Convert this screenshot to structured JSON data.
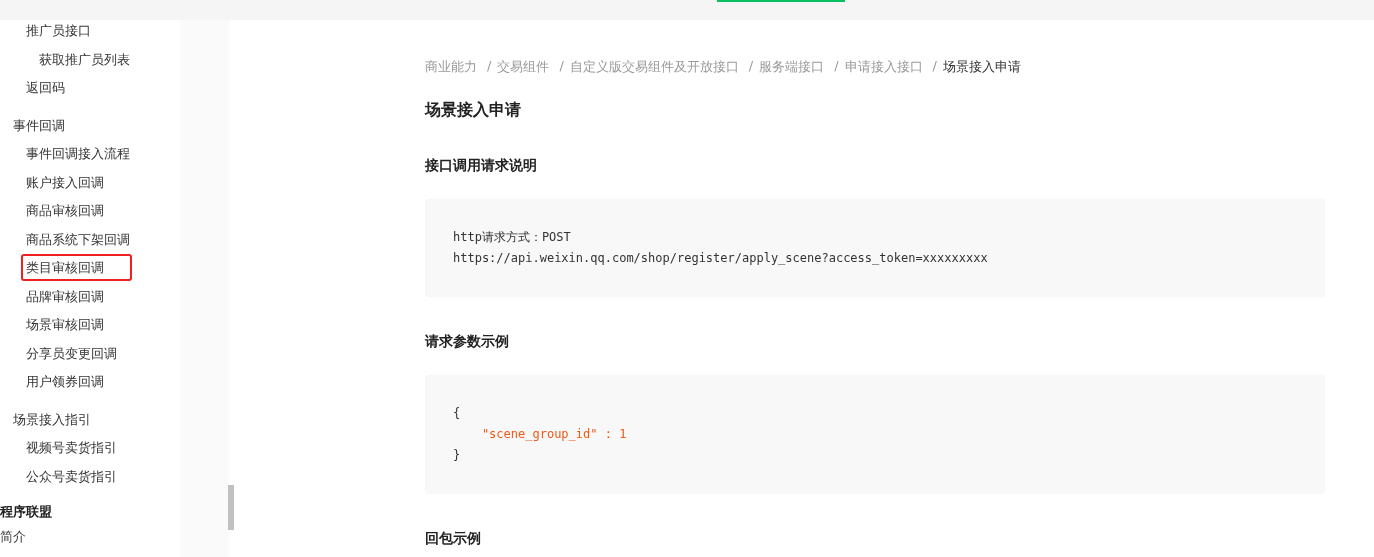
{
  "top_nav": {
    "active_tab": {
      "selected": true
    }
  },
  "sidebar": {
    "tree": [
      {
        "children": [
          {
            "label": "推广员接口",
            "highlighted": false,
            "children": [
              {
                "label": "获取推广员列表",
                "highlighted": false
              }
            ]
          },
          {
            "label": "返回码",
            "highlighted": false
          }
        ]
      },
      {
        "label": "事件回调",
        "highlighted": false,
        "children": [
          {
            "label": "事件回调接入流程",
            "highlighted": false
          },
          {
            "label": "账户接入回调",
            "highlighted": false
          },
          {
            "label": "商品审核回调",
            "highlighted": false
          },
          {
            "label": "商品系统下架回调",
            "highlighted": false
          },
          {
            "label": "类目审核回调",
            "highlighted": true
          },
          {
            "label": "品牌审核回调",
            "highlighted": false
          },
          {
            "label": "场景审核回调",
            "highlighted": false
          },
          {
            "label": "分享员变更回调",
            "highlighted": false
          },
          {
            "label": "用户领券回调",
            "highlighted": false
          }
        ]
      },
      {
        "label": "场景接入指引",
        "highlighted": false,
        "children": [
          {
            "label": "视频号卖货指引",
            "highlighted": false
          },
          {
            "label": "公众号卖货指引",
            "highlighted": false
          }
        ]
      }
    ],
    "next_section": {
      "title": "程序联盟",
      "items": [
        "简介"
      ]
    }
  },
  "breadcrumb": {
    "separator": "/",
    "items": [
      "商业能力",
      "交易组件",
      "自定义版交易组件及开放接口",
      "服务端接口",
      "申请接入接口",
      "场景接入申请"
    ]
  },
  "title": "场景接入申请",
  "sections": [
    {
      "heading": "接口调用请求说明",
      "code": [
        {
          "kind": "plain",
          "text": "http请求方式：POST"
        },
        {
          "kind": "plain",
          "text": "https://api.weixin.qq.com/shop/register/apply_scene?access_token=xxxxxxxxx"
        }
      ]
    },
    {
      "heading": "请求参数示例",
      "code": [
        {
          "kind": "plain",
          "text": "{"
        },
        {
          "kind": "string",
          "text": "    \"scene_group_id\" : 1"
        },
        {
          "kind": "plain",
          "text": "}"
        }
      ]
    },
    {
      "heading": "回包示例"
    }
  ]
}
